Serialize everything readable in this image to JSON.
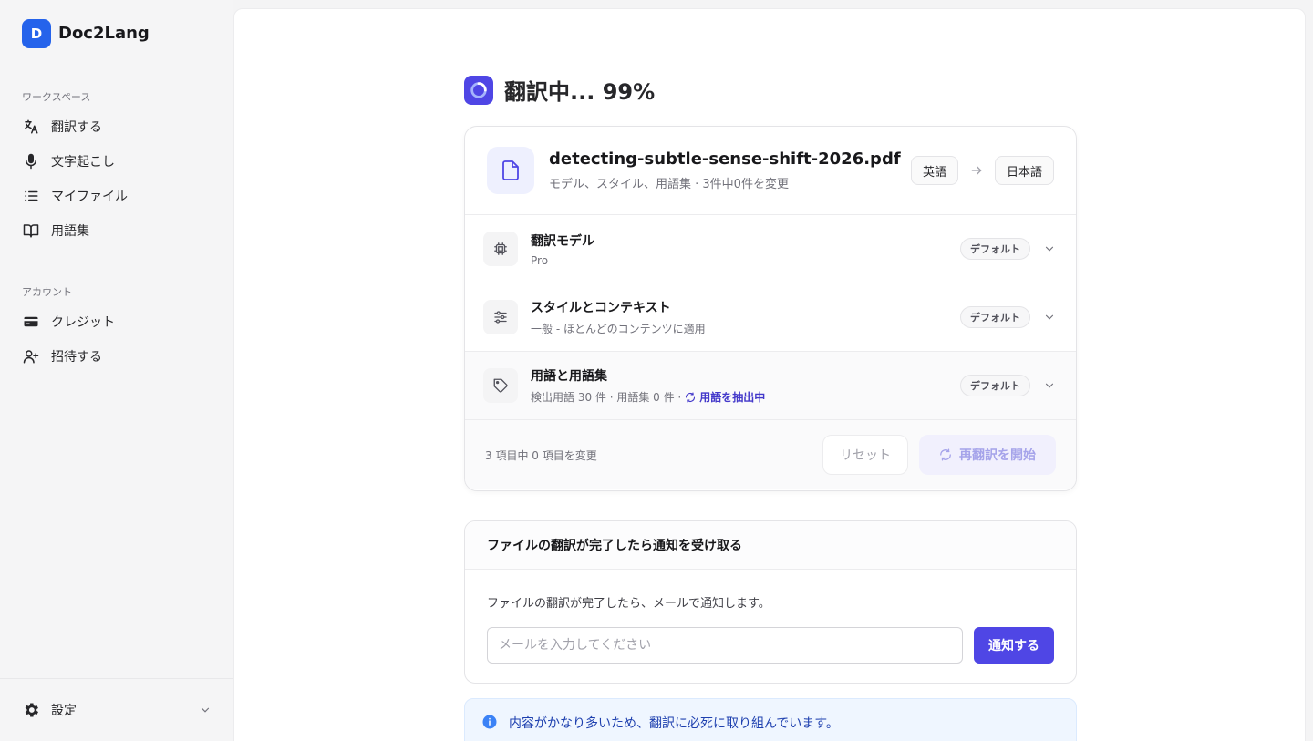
{
  "app": {
    "name": "Doc2Lang",
    "logo_letter": "D"
  },
  "sidebar": {
    "workspace_heading": "ワークスペース",
    "workspace_items": [
      {
        "label": "翻訳する",
        "icon": "translate-icon"
      },
      {
        "label": "文字起こし",
        "icon": "microphone-icon"
      },
      {
        "label": "マイファイル",
        "icon": "list-icon"
      },
      {
        "label": "用語集",
        "icon": "book-icon"
      }
    ],
    "account_heading": "アカウント",
    "account_items": [
      {
        "label": "クレジット",
        "icon": "credit-card-icon"
      },
      {
        "label": "招待する",
        "icon": "user-plus-icon"
      }
    ],
    "settings_label": "設定"
  },
  "main": {
    "title": "翻訳中... 99%",
    "file": {
      "name": "detecting-subtle-sense-shift-2026.pdf",
      "subtitle": "モデル、スタイル、用語集 · 3件中0件を変更",
      "source_lang": "英語",
      "target_lang": "日本語"
    },
    "options": [
      {
        "title": "翻訳モデル",
        "subtitle": "Pro",
        "badge": "デフォルト",
        "icon": "chip-icon"
      },
      {
        "title": "スタイルとコンテキスト",
        "subtitle": "一般 - ほとんどのコンテンツに適用",
        "badge": "デフォルト",
        "icon": "sliders-icon"
      },
      {
        "title": "用語と用語集",
        "subtitle": "検出用語 30 件 · 用語集 0 件 ·",
        "extract_label": "用語を抽出中",
        "badge": "デフォルト",
        "icon": "tag-icon"
      }
    ],
    "footer": {
      "changed_count": "3 項目中 0 項目を変更",
      "reset_label": "リセット",
      "restart_label": "再翻訳を開始"
    },
    "notify": {
      "heading": "ファイルの翻訳が完了したら通知を受け取る",
      "description": "ファイルの翻訳が完了したら、メールで通知します。",
      "email_value": "",
      "email_placeholder": "メールを入力してください",
      "button_label": "通知する"
    },
    "info_message": "内容がかなり多いため、翻訳に必死に取り組んでいます。"
  },
  "colors": {
    "brand": "#2563eb",
    "accent": "#4f46e5",
    "info_bg": "#eff6ff",
    "info_text": "#1e40af"
  }
}
